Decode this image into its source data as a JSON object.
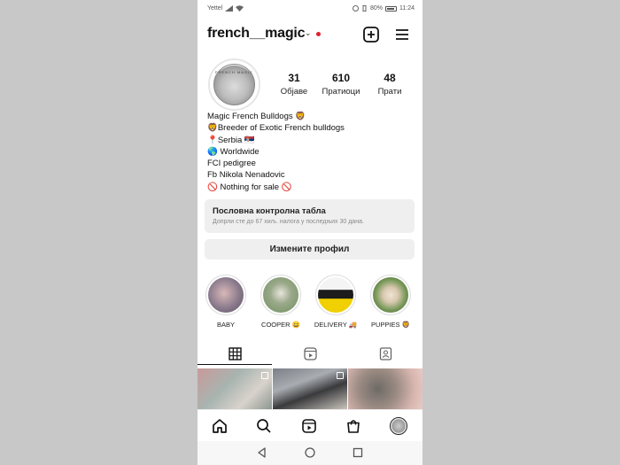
{
  "status_bar": {
    "carrier": "Yettel",
    "battery": "80%",
    "time": "11:24"
  },
  "header": {
    "username": "french__magic",
    "create_icon": "plus-square-icon",
    "menu_icon": "hamburger-menu-icon"
  },
  "profile": {
    "avatar_text": "FRENCH MAGIC",
    "stats": [
      {
        "value": "31",
        "label": "Објаве"
      },
      {
        "value": "610",
        "label": "Пратиоци"
      },
      {
        "value": "48",
        "label": "Прати"
      }
    ],
    "bio": [
      "Magic French Bulldogs 🦁",
      "🦁Breeder of Exotic French bulldogs",
      "📍Serbia 🇷🇸",
      "🌎 Worldwide",
      "FCI pedigree",
      "Fb Nikola Nenadovic",
      "🚫 Nothing for sale 🚫"
    ]
  },
  "dashboard": {
    "title": "Пословна контролна табла",
    "subtitle": "Допрли сте до 67 хиљ. налога у последњих 30 дана."
  },
  "edit_profile_label": "Измените профил",
  "highlights": [
    {
      "label": "BABY",
      "color": "#8a7a8c"
    },
    {
      "label": "COOPER 😄",
      "color": "#6f8f5f"
    },
    {
      "label": "DELIVERY 🚚",
      "color": "#f0d000"
    },
    {
      "label": "PUPPIES 🦁",
      "color": "#7a9a5a"
    }
  ],
  "tabs": [
    {
      "name": "grid",
      "icon": "grid-icon",
      "active": true
    },
    {
      "name": "reels",
      "icon": "reels-icon",
      "active": false
    },
    {
      "name": "tagged",
      "icon": "tagged-icon",
      "active": false
    }
  ],
  "bottom_nav": [
    "home-icon",
    "search-icon",
    "reels-icon",
    "shop-icon",
    "profile-avatar"
  ],
  "colors": {
    "notification_dot": "#e0202e",
    "panel_bg": "#efefef"
  }
}
